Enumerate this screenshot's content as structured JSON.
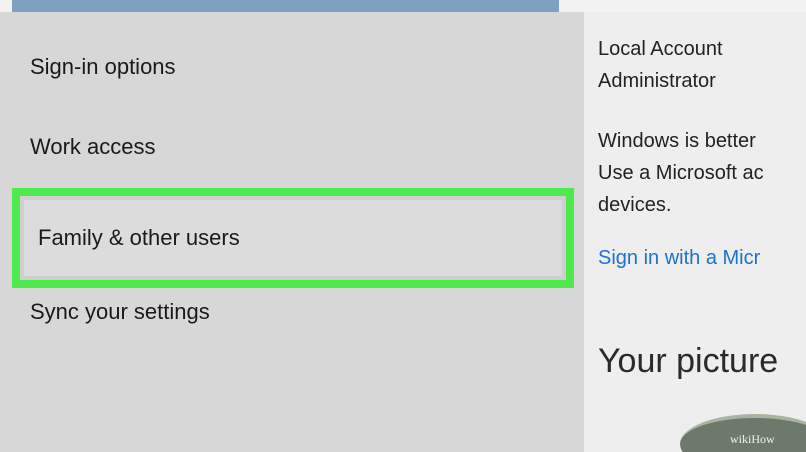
{
  "nav": {
    "items": [
      {
        "label": "Sign-in options"
      },
      {
        "label": "Work access"
      },
      {
        "label": "Family & other users",
        "selected": true
      },
      {
        "label": "Sync your settings"
      }
    ]
  },
  "content": {
    "account": {
      "line1": "Local Account",
      "line2": "Administrator"
    },
    "message": {
      "line1": "Windows is better",
      "line2": "Use a Microsoft ac",
      "line3": "devices."
    },
    "link": "Sign in with a Micr",
    "section_title": "Your picture"
  },
  "avatar": {
    "watermark": "wikiHow"
  },
  "colors": {
    "highlight": "#4fe94b",
    "link": "#1b73c9",
    "nav_bg": "#d7d7d7",
    "content_bg": "#eeeeee",
    "accent": "#7fa0bf"
  }
}
